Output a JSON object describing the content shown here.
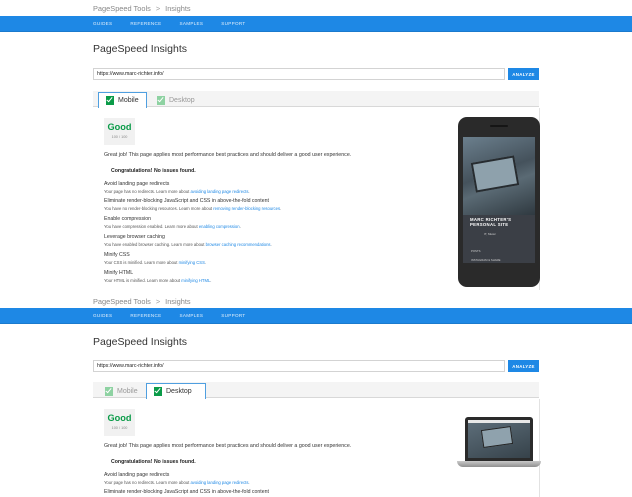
{
  "breadcrumb": {
    "root": "PageSpeed Tools",
    "separator": ">",
    "current": "Insights"
  },
  "nav": [
    "GUIDES",
    "REFERENCE",
    "SAMPLES",
    "SUPPORT"
  ],
  "page_title": "PageSpeed Insights",
  "url_input": {
    "value": "https://www.marc-richter.info/"
  },
  "analyze_label": "ANALYZE",
  "tabs": {
    "mobile": "Mobile",
    "desktop": "Desktop"
  },
  "score": {
    "label": "Good",
    "value": "100 / 100"
  },
  "summary": "Great job! This page applies most performance best practices and should deliver a good user experience.",
  "congrats": "Congratulations! No issues found.",
  "rules": [
    {
      "title": "Avoid landing page redirects",
      "desc": "Your page has no redirects. Learn more about ",
      "link": "avoiding landing page redirects",
      "end": "."
    },
    {
      "title": "Eliminate render-blocking JavaScript and CSS in above-the-fold content",
      "desc": "You have no render-blocking resources. Learn more about ",
      "link": "removing render-blocking resources",
      "end": "."
    },
    {
      "title": "Enable compression",
      "desc": "You have compression enabled. Learn more about ",
      "link": "enabling compression",
      "end": "."
    },
    {
      "title": "Leverage browser caching",
      "desc": "You have enabled browser caching. Learn more about ",
      "link": "browser caching recommendations",
      "end": "."
    },
    {
      "title": "Minify CSS",
      "desc": "Your CSS is minified. Learn more about ",
      "link": "minifying CSS",
      "end": "."
    },
    {
      "title": "Minify HTML",
      "desc": "Your HTML is minified. Learn more about ",
      "link": "minifying HTML",
      "end": "."
    }
  ],
  "preview": {
    "site_name_1": "MARC RICHTER'S",
    "site_name_2": "PERSONAL SITE",
    "sub": "IT, Music",
    "foot1": "POSTS",
    "foot2": "INSTAGRAM & SHARE"
  },
  "colors": {
    "nav": "#1e88e5",
    "good": "#0a9b48",
    "link": "#1e88e5"
  }
}
